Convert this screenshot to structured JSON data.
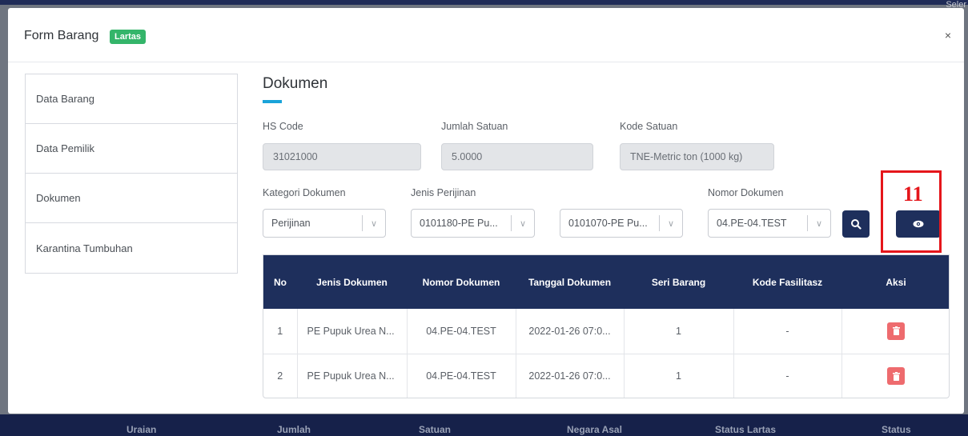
{
  "modal": {
    "title": "Form Barang",
    "badge": "Lartas",
    "close": "×"
  },
  "side_menu": [
    "Data Barang",
    "Data Pemilik",
    "Dokumen",
    "Karantina Tumbuhan"
  ],
  "section": {
    "title": "Dokumen"
  },
  "fields": {
    "hs_code": {
      "label": "HS Code",
      "value": "31021000"
    },
    "jumlah_satuan": {
      "label": "Jumlah Satuan",
      "value": "5.0000"
    },
    "kode_satuan": {
      "label": "Kode Satuan",
      "value": "TNE-Metric ton (1000 kg)"
    }
  },
  "filters": {
    "kategori": {
      "label": "Kategori Dokumen",
      "value": "Perijinan"
    },
    "jenis": {
      "label": "Jenis Perijinan",
      "value": "0101180-PE Pu..."
    },
    "jenis2": {
      "value": "0101070-PE Pu..."
    },
    "nomor": {
      "label": "Nomor Dokumen",
      "value": "04.PE-04.TEST"
    }
  },
  "annotation": {
    "number": "11"
  },
  "table": {
    "headers": [
      "No",
      "Jenis Dokumen",
      "Nomor Dokumen",
      "Tanggal Dokumen",
      "Seri Barang",
      "Kode Fasilitasz",
      "Aksi"
    ],
    "rows": [
      {
        "no": "1",
        "jenis": "PE Pupuk Urea N...",
        "nomor": "04.PE-04.TEST",
        "tanggal": "2022-01-26 07:0...",
        "seri": "1",
        "kode": "-"
      },
      {
        "no": "2",
        "jenis": "PE Pupuk Urea N...",
        "nomor": "04.PE-04.TEST",
        "tanggal": "2022-01-26 07:0...",
        "seri": "1",
        "kode": "-"
      }
    ]
  },
  "background": {
    "corner_text": "Seler",
    "footer": [
      "Uraian",
      "Jumlah",
      "Satuan",
      "Negara Asal",
      "Status Lartas",
      "Status"
    ]
  },
  "colors": {
    "navy": "#1e2f5c",
    "accent": "#1aa3d9",
    "badge": "#34b56a",
    "delete": "#ee6b6e",
    "annotation": "#e5161b"
  },
  "icons": {
    "search": "search-icon",
    "view": "eye-icon",
    "delete": "trash-icon",
    "dropdown": "chevron-down-icon"
  }
}
